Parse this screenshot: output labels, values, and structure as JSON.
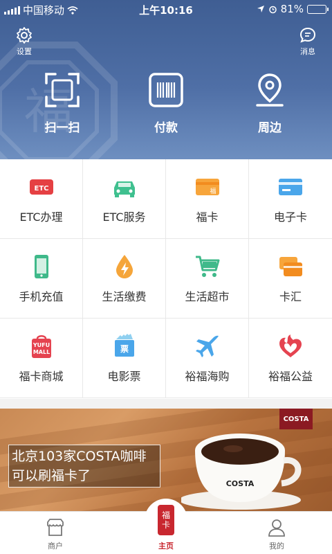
{
  "status_bar": {
    "carrier": "中国移动",
    "time": "上午10:16",
    "battery": "81%",
    "battery_level": 0.81
  },
  "header": {
    "settings_label": "设置",
    "messages_label": "消息",
    "quick_actions": [
      {
        "label": "扫一扫",
        "icon": "scan-icon"
      },
      {
        "label": "付款",
        "icon": "barcode-icon"
      },
      {
        "label": "周边",
        "icon": "location-pin-icon"
      }
    ]
  },
  "services": [
    {
      "label": "ETC办理",
      "icon": "etc-card-icon"
    },
    {
      "label": "ETC服务",
      "icon": "car-icon"
    },
    {
      "label": "福卡",
      "icon": "fu-card-icon"
    },
    {
      "label": "电子卡",
      "icon": "e-card-icon"
    },
    {
      "label": "手机充值",
      "icon": "phone-icon"
    },
    {
      "label": "生活缴费",
      "icon": "utility-drop-icon"
    },
    {
      "label": "生活超市",
      "icon": "cart-icon"
    },
    {
      "label": "卡汇",
      "icon": "cards-icon"
    },
    {
      "label": "福卡商城",
      "icon": "mall-bag-icon"
    },
    {
      "label": "电影票",
      "icon": "ticket-icon"
    },
    {
      "label": "裕福海购",
      "icon": "plane-icon"
    },
    {
      "label": "裕福公益",
      "icon": "charity-heart-icon"
    }
  ],
  "banner": {
    "brand_logo": "COSTA",
    "line1": "北京103家COSTA咖啡",
    "line2": "可以刷福卡了",
    "cup_brand": "COSTA"
  },
  "tabbar": {
    "tabs": [
      {
        "label": "商户",
        "icon": "store-icon"
      },
      {
        "label": "主页",
        "icon": "fu-seal-icon"
      },
      {
        "label": "我的",
        "icon": "user-icon"
      }
    ],
    "seal_text_top": "福",
    "seal_text_bottom": "卡",
    "active": "主页"
  },
  "colors": {
    "header_blue": "#4a6aa2",
    "accent_red": "#c8272f"
  }
}
